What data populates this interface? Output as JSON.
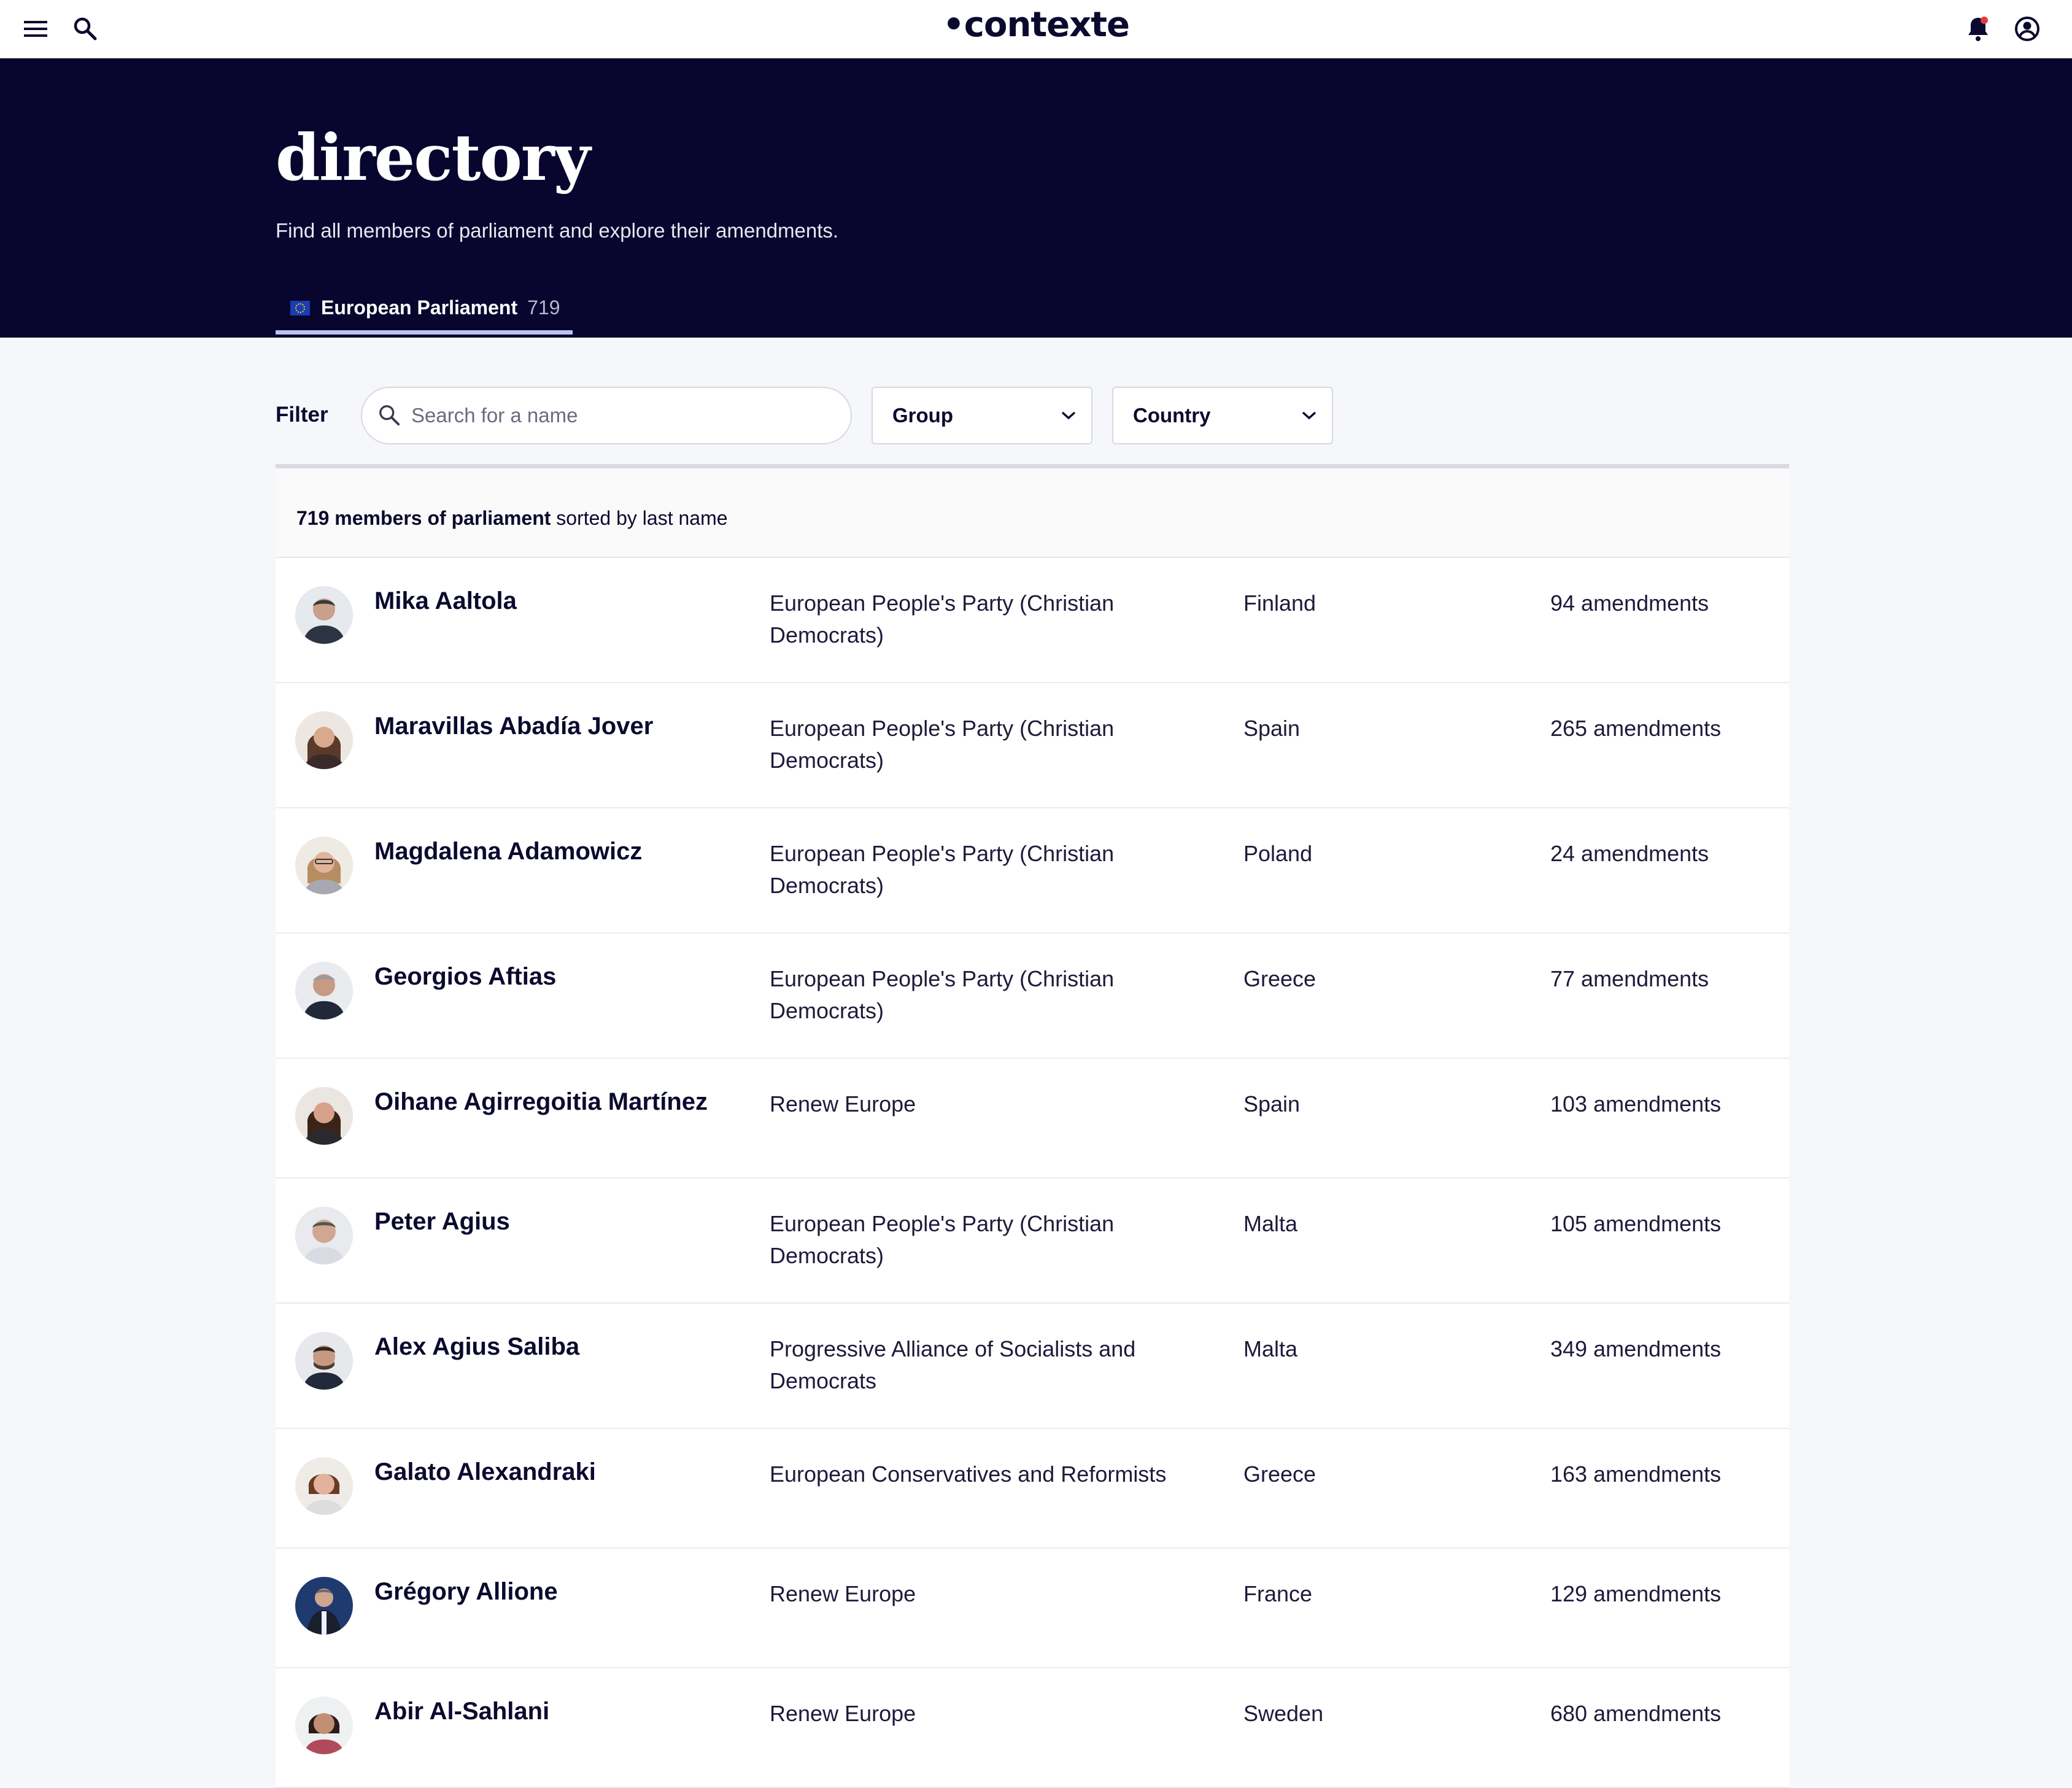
{
  "header": {
    "logo": "•contexte",
    "menu_icon": "hamburger-menu-icon",
    "search_icon": "search-icon",
    "notifications_icon": "bell-icon",
    "account_icon": "user-circle-icon"
  },
  "hero": {
    "title": "directory",
    "subtitle": "Find all members of parliament and explore their amendments.",
    "tab": {
      "label": "European Parliament",
      "count": "719",
      "icon": "eu-flag-icon"
    }
  },
  "filters": {
    "label": "Filter",
    "search_placeholder": "Search for a name",
    "search_value": "",
    "group_label": "Group",
    "country_label": "Country"
  },
  "summary": {
    "count_label": "719 members of parliament",
    "sort_label": " sorted by last name"
  },
  "colors": {
    "hero_bg": "#08052e",
    "tab_underline": "#b9c3f2",
    "text": "#0b0a2e"
  },
  "members": [
    {
      "name": "Mika Aaltola",
      "group": "European People's Party (Christian Democrats)",
      "country": "Finland",
      "amendments": "94 amendments"
    },
    {
      "name": "Maravillas Abadía Jover",
      "group": "European People's Party (Christian Democrats)",
      "country": "Spain",
      "amendments": "265 amendments"
    },
    {
      "name": "Magdalena Adamowicz",
      "group": "European People's Party (Christian Democrats)",
      "country": "Poland",
      "amendments": "24 amendments"
    },
    {
      "name": "Georgios Aftias",
      "group": "European People's Party (Christian Democrats)",
      "country": "Greece",
      "amendments": "77 amendments"
    },
    {
      "name": "Oihane Agirregoitia Martínez",
      "group": "Renew Europe",
      "country": "Spain",
      "amendments": "103 amendments"
    },
    {
      "name": "Peter Agius",
      "group": "European People's Party (Christian Democrats)",
      "country": "Malta",
      "amendments": "105 amendments"
    },
    {
      "name": "Alex Agius Saliba",
      "group": "Progressive Alliance of Socialists and Democrats",
      "country": "Malta",
      "amendments": "349 amendments"
    },
    {
      "name": "Galato Alexandraki",
      "group": "European Conservatives and Reformists",
      "country": "Greece",
      "amendments": "163 amendments"
    },
    {
      "name": "Grégory Allione",
      "group": "Renew Europe",
      "country": "France",
      "amendments": "129 amendments"
    },
    {
      "name": "Abir Al-Sahlani",
      "group": "Renew Europe",
      "country": "Sweden",
      "amendments": "680 amendments"
    }
  ]
}
